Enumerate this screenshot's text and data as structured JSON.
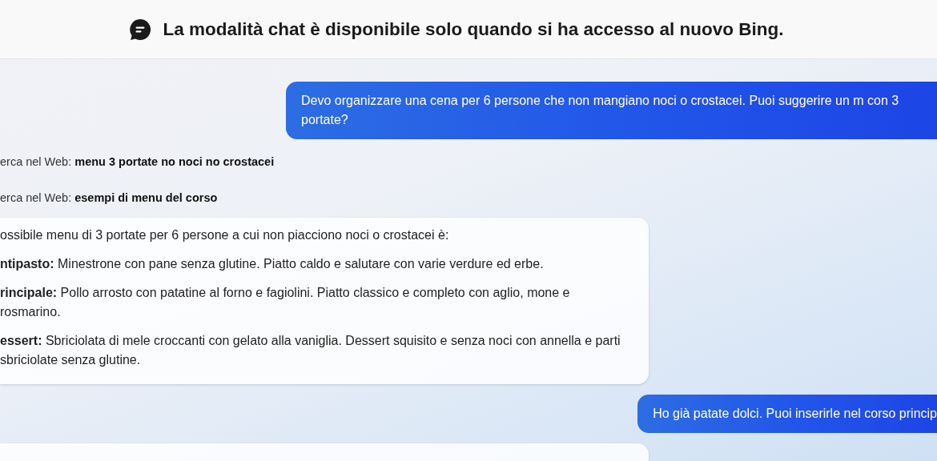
{
  "header": {
    "text": "La modalità chat è disponibile solo quando si ha accesso al nuovo Bing."
  },
  "messages": [
    {
      "kind": "user",
      "text": "Devo organizzare una cena per 6 persone che non mangiano noci o crostacei. Puoi suggerire un m con 3 portate?"
    },
    {
      "kind": "search",
      "text": "erca nel Web: **menu 3 portate no noci no crostacei**"
    },
    {
      "kind": "search",
      "text": "erca nel Web: **esempi di menu del corso**"
    },
    {
      "kind": "answer",
      "paragraphs": [
        "ossibile menu di 3 portate per 6 persone a cui non piacciono noci o crostacei è:",
        "**ntipasto:** Minestrone con pane senza glutine. Piatto caldo e salutare con varie verdure ed erbe.",
        "**rincipale:** Pollo arrosto con patatine al forno e fagiolini. Piatto classico e completo con aglio, mone e rosmarino.",
        "**essert:** Sbriciolata di mele croccanti con gelato alla vaniglia. Dessert squisito e senza noci con annella e parti sbriciolate senza glutine."
      ]
    },
    {
      "kind": "user",
      "text": "Ho già patate dolci. Puoi inserirle nel corso princip"
    },
    {
      "kind": "answer"
    }
  ]
}
